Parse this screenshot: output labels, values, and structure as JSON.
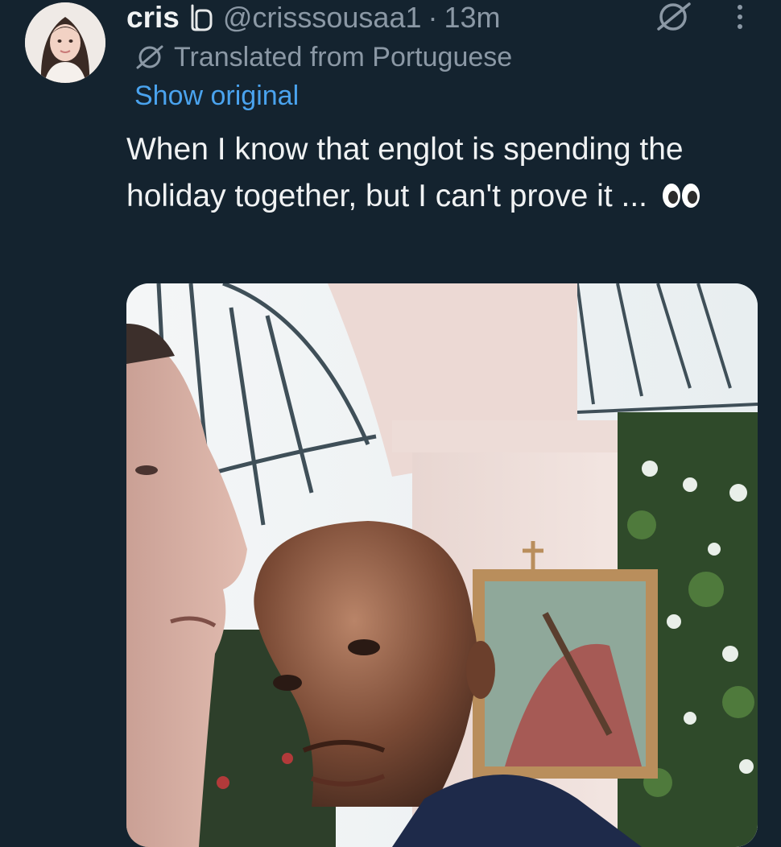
{
  "tweet": {
    "author": {
      "display_name": "cris",
      "handle": "@crisssousaa1",
      "separator": "·",
      "time": "13m",
      "name_emoji": "interlocking-shapes-emoji"
    },
    "translation": {
      "label": "Translated from Portuguese",
      "show_original": "Show original",
      "icon": "translate-icon"
    },
    "text": "When I know that englot is spending the holiday together, but I can't prove it ...",
    "text_emoji": "eyes-emoji",
    "media": {
      "type": "video-still"
    }
  },
  "colors": {
    "background": "#14232f",
    "primary_text": "#f0f2f3",
    "secondary_text": "#8b98a5",
    "link": "#4aa3ee"
  },
  "icons": [
    "translate-icon",
    "more-options-icon",
    "eyes-emoji",
    "interlocking-shapes-emoji"
  ]
}
